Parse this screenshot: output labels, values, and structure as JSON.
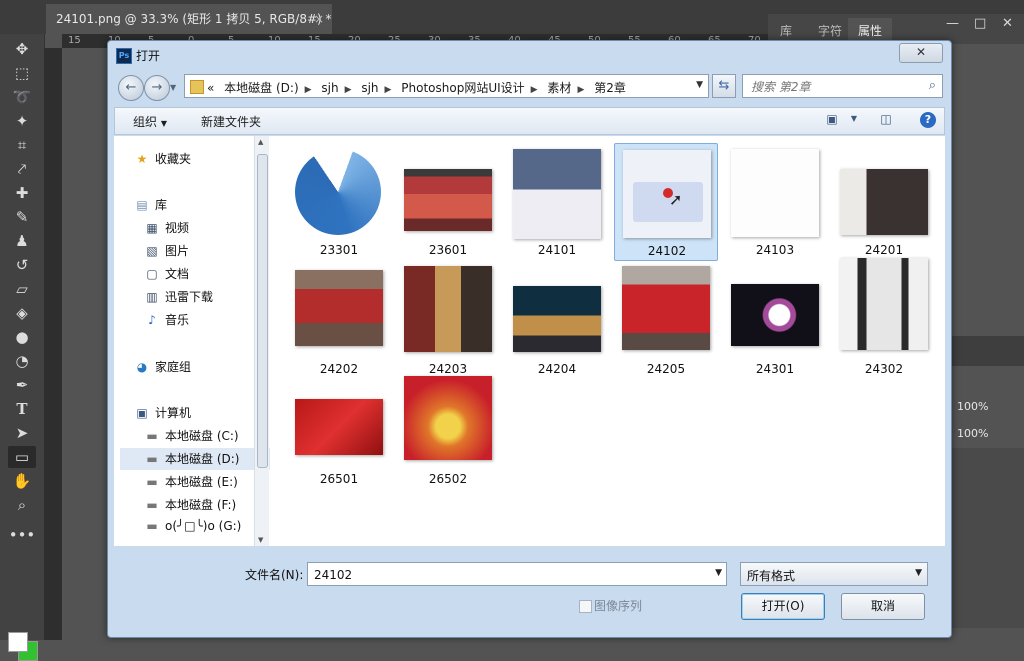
{
  "ps": {
    "doc_tab": "24101.png @ 33.3% (矩形 1 拷贝 5, RGB/8#) *",
    "doc_close": "×",
    "ruler_marks": [
      "15",
      "10",
      "5",
      "0",
      "5",
      "10",
      "15",
      "20",
      "25",
      "30",
      "35",
      "40",
      "45",
      "50",
      "55",
      "60",
      "65",
      "70"
    ],
    "panel_tabs": [
      "库",
      "字符",
      "属性"
    ],
    "window_controls": [
      "—",
      "□",
      "✕"
    ],
    "pct_1": "100%",
    "pct_2": "100%",
    "colors": {
      "foreground": "#ffffff",
      "background": "#31c131"
    }
  },
  "dialog": {
    "title": "打开",
    "close": "✕",
    "breadcrumbs": [
      "«",
      "本地磁盘 (D:)",
      "sjh",
      "sjh",
      "Photoshop网站UI设计",
      "素材",
      "第2章"
    ],
    "search_placeholder": "搜索 第2章",
    "toolbar": {
      "organize": "组织",
      "new_folder": "新建文件夹"
    },
    "nav": {
      "favorites": "收藏夹",
      "library": "库",
      "library_items": [
        "视频",
        "图片",
        "文档",
        "迅雷下载",
        "音乐"
      ],
      "homegroup": "家庭组",
      "computer": "计算机",
      "drives": [
        "本地磁盘 (C:)",
        "本地磁盘 (D:)",
        "本地磁盘 (E:)",
        "本地磁盘 (F:)",
        "o(╯□╰)o (G:)"
      ]
    },
    "files": [
      "23301",
      "23601",
      "24101",
      "24102",
      "24103",
      "24201",
      "24202",
      "24203",
      "24204",
      "24205",
      "24301",
      "24302",
      "26501",
      "26502"
    ],
    "selected_file": "24102",
    "filename_label": "文件名(N):",
    "filename_value": "24102",
    "file_type": "所有格式",
    "image_sequence_label": "图像序列",
    "open_button": "打开(O)",
    "cancel_button": "取消"
  }
}
